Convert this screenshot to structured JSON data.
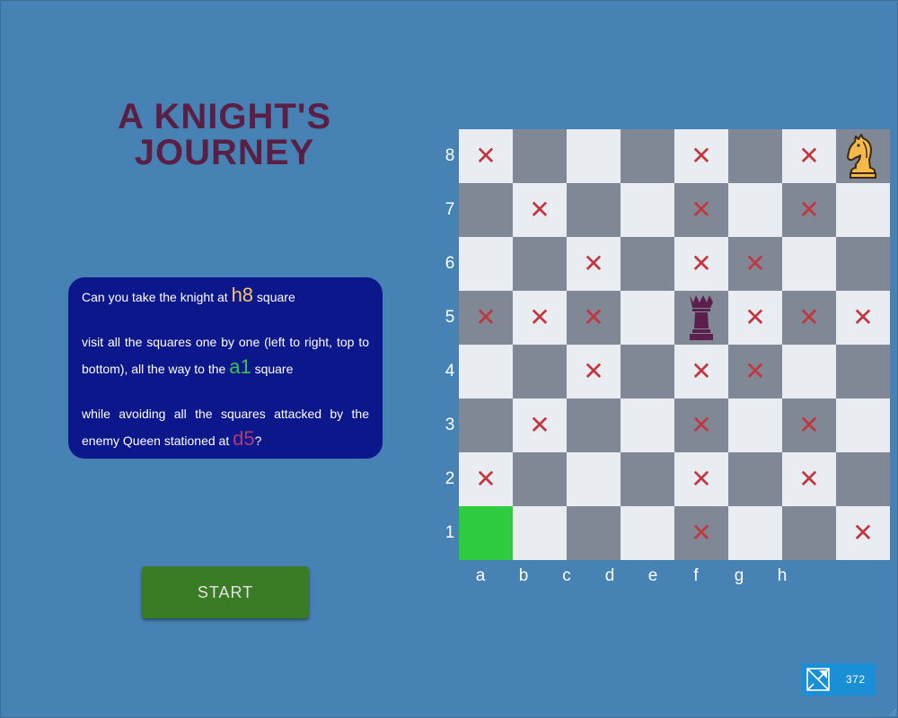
{
  "title": {
    "line1": "A KNIGHT'S",
    "line2": "JOURNEY"
  },
  "instructions": {
    "p1_pre": "Can you take the knight at ",
    "p1_square": "h8",
    "p1_post": " square",
    "p2_pre": "visit all the squares one by one (left to right, top to bottom), all the way to the ",
    "p2_square": "a1",
    "p2_post": " square",
    "p3_pre": "while avoiding all the squares attacked by the enemy Queen stationed at ",
    "p3_square": "d5",
    "p3_post": "?"
  },
  "start_label": "START",
  "board": {
    "ranks": [
      "8",
      "7",
      "6",
      "5",
      "4",
      "3",
      "2",
      "1"
    ],
    "files": [
      "a",
      "b",
      "c",
      "d",
      "e",
      "f",
      "g",
      "h"
    ],
    "mark_glyph": "✕",
    "knight_square": "h8",
    "queen_square": "e5",
    "goal_square": "a1",
    "attacked_squares": [
      "a8",
      "e8",
      "g8",
      "b7",
      "e7",
      "g7",
      "c6",
      "e6",
      "f6",
      "a5",
      "b5",
      "c5",
      "f5",
      "g5",
      "h5",
      "c4",
      "e4",
      "f4",
      "b3",
      "e3",
      "g3",
      "a2",
      "e2",
      "g2",
      "e1",
      "h1"
    ],
    "colors": {
      "light": "#e9ecf1",
      "dark": "#808895",
      "goal": "#2ecc40",
      "mark": "#c2373f"
    }
  },
  "badge": {
    "icon": "puzzle-logo-icon",
    "count": "372"
  }
}
